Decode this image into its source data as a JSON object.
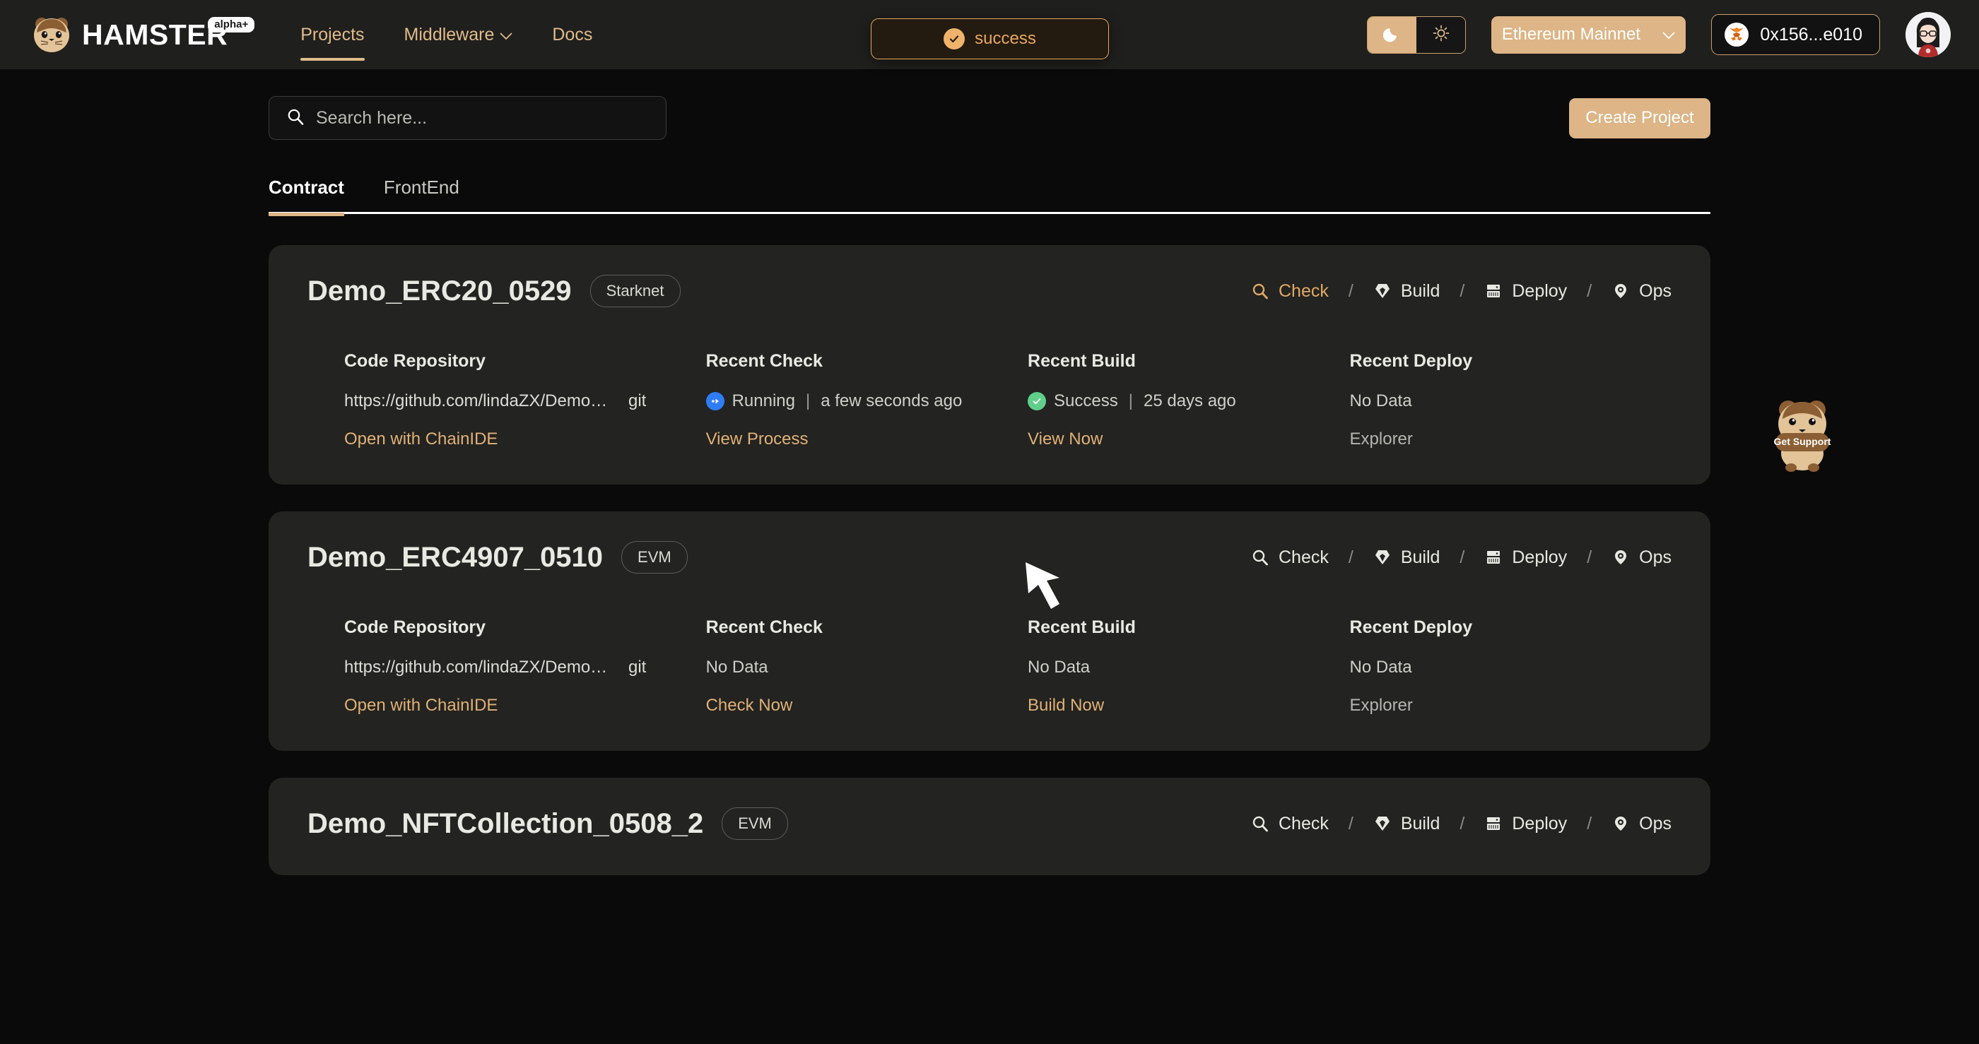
{
  "header": {
    "logo_text": "HAMSTER",
    "logo_badge": "alpha+",
    "nav": [
      {
        "label": "Projects",
        "active": true,
        "chevron": false
      },
      {
        "label": "Middleware",
        "active": false,
        "chevron": true
      },
      {
        "label": "Docs",
        "active": false,
        "chevron": false
      }
    ],
    "toast": {
      "label": "success",
      "icon": "check-circle-icon",
      "border_color": "#e5aa63",
      "text_color": "#e8a85f"
    },
    "theme_toggle": {
      "dark_icon": "moon-icon",
      "light_icon": "sun-icon",
      "active": "dark"
    },
    "network": {
      "label": "Ethereum Mainnet",
      "icon": "chevron-down-icon"
    },
    "wallet": {
      "address": "0x156...e010",
      "icon": "metamask-fox-icon"
    },
    "avatar_name": "user-avatar"
  },
  "toolbar": {
    "search_placeholder": "Search here...",
    "search_value": "",
    "search_icon": "search-icon",
    "create_label": "Create Project"
  },
  "tabs": [
    {
      "label": "Contract",
      "active": true
    },
    {
      "label": "FrontEnd",
      "active": false
    }
  ],
  "column_headers": {
    "repo": "Code Repository",
    "check": "Recent Check",
    "build": "Recent Build",
    "deploy": "Recent Deploy"
  },
  "actions": [
    {
      "label": "Check",
      "icon": "magnifier-icon"
    },
    {
      "label": "Build",
      "icon": "diamond-icon"
    },
    {
      "label": "Deploy",
      "icon": "server-rack-icon"
    },
    {
      "label": "Ops",
      "icon": "location-pin-icon"
    }
  ],
  "action_separator": "/",
  "cards": [
    {
      "title": "Demo_ERC20_0529",
      "chain": "Starknet",
      "active_action": "Check",
      "repo": {
        "url": "https://github.com/lindaZX/Demo_ER...",
        "tag": "git",
        "link": "Open with ChainIDE"
      },
      "check": {
        "status": "Running",
        "status_type": "running",
        "time": "a few seconds ago",
        "link": "View Process",
        "link_muted": false
      },
      "build": {
        "status": "Success",
        "status_type": "success",
        "time": "25 days ago",
        "link": "View Now",
        "link_muted": false
      },
      "deploy": {
        "status": "No Data",
        "status_type": "none",
        "time": "",
        "link": "Explorer",
        "link_muted": true
      }
    },
    {
      "title": "Demo_ERC4907_0510",
      "chain": "EVM",
      "active_action": "",
      "repo": {
        "url": "https://github.com/lindaZX/Demo_ER...",
        "tag": "git",
        "link": "Open with ChainIDE"
      },
      "check": {
        "status": "No Data",
        "status_type": "none",
        "time": "",
        "link": "Check Now",
        "link_muted": false
      },
      "build": {
        "status": "No Data",
        "status_type": "none",
        "time": "",
        "link": "Build Now",
        "link_muted": false
      },
      "deploy": {
        "status": "No Data",
        "status_type": "none",
        "time": "",
        "link": "Explorer",
        "link_muted": true
      }
    },
    {
      "title": "Demo_NFTCollection_0508_2",
      "chain": "EVM",
      "active_action": "",
      "repo": {
        "url": "",
        "tag": "",
        "link": ""
      },
      "check": {
        "status": "",
        "status_type": "none",
        "time": "",
        "link": "",
        "link_muted": false
      },
      "build": {
        "status": "",
        "status_type": "none",
        "time": "",
        "link": "",
        "link_muted": false
      },
      "deploy": {
        "status": "",
        "status_type": "none",
        "time": "",
        "link": "",
        "link_muted": true
      }
    }
  ],
  "support": {
    "label": "Get Support",
    "icon": "hamster-mascot-icon"
  },
  "colors": {
    "page_bg": "#0a0a0a",
    "header_bg": "#1f1f1d",
    "card_bg": "#232321",
    "accent_tan": "#ddb586",
    "accent_gold": "#e0bb8a",
    "link_tan": "#e0b176",
    "running_blue": "#2f7df6",
    "success_green": "#5fcf8a"
  }
}
